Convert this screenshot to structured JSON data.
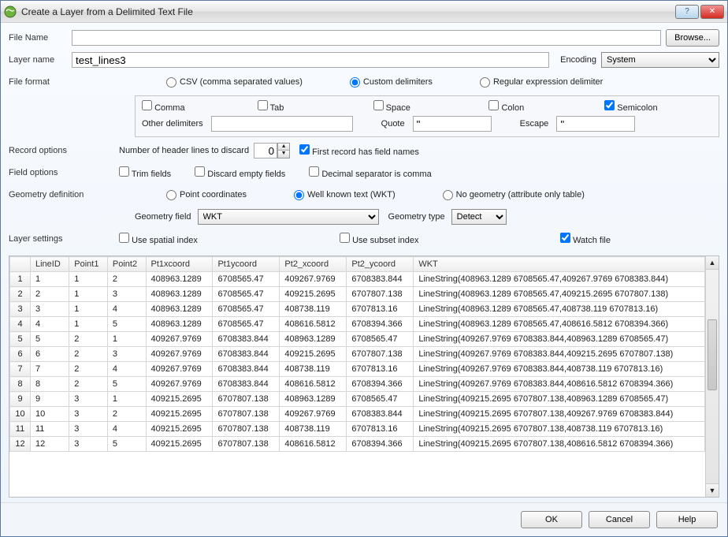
{
  "window": {
    "title": "Create a Layer from a Delimited Text File",
    "help_btn": "?",
    "close_btn": "✕"
  },
  "file": {
    "name_label": "File Name",
    "name_value": "",
    "browse_label": "Browse...",
    "layer_name_label": "Layer name",
    "layer_name_value": "test_lines3",
    "encoding_label": "Encoding",
    "encoding_value": "System"
  },
  "format": {
    "label": "File format",
    "csv_label": "CSV (comma separated values)",
    "custom_label": "Custom delimiters",
    "regex_label": "Regular expression delimiter",
    "comma_label": "Comma",
    "tab_label": "Tab",
    "space_label": "Space",
    "colon_label": "Colon",
    "semicolon_label": "Semicolon",
    "other_label": "Other delimiters",
    "other_value": "",
    "quote_label": "Quote",
    "quote_value": "\"",
    "escape_label": "Escape",
    "escape_value": "\""
  },
  "record": {
    "label": "Record options",
    "header_discard_label": "Number of header lines to discard",
    "header_discard_value": "0",
    "first_record_label": "First record has field names"
  },
  "fieldopt": {
    "label": "Field options",
    "trim_label": "Trim fields",
    "discard_empty_label": "Discard empty fields",
    "decimal_comma_label": "Decimal separator is comma"
  },
  "geom": {
    "label": "Geometry definition",
    "point_label": "Point coordinates",
    "wkt_label": "Well known text (WKT)",
    "nogeom_label": "No geometry (attribute only table)",
    "geomfield_label": "Geometry field",
    "geomfield_value": "WKT",
    "geomtype_label": "Geometry type",
    "geomtype_value": "Detect"
  },
  "layerset": {
    "label": "Layer settings",
    "spatial_label": "Use spatial index",
    "subset_label": "Use subset index",
    "watch_label": "Watch file"
  },
  "table": {
    "headers": [
      "LineID",
      "Point1",
      "Point2",
      "Pt1xcoord",
      "Pt1ycoord",
      "Pt2_xcoord",
      "Pt2_ycoord",
      "WKT"
    ],
    "rows": [
      [
        "1",
        "1",
        "2",
        "408963.1289",
        "6708565.47",
        "409267.9769",
        "6708383.844",
        "LineString(408963.1289 6708565.47,409267.9769 6708383.844)"
      ],
      [
        "2",
        "1",
        "3",
        "408963.1289",
        "6708565.47",
        "409215.2695",
        "6707807.138",
        "LineString(408963.1289 6708565.47,409215.2695 6707807.138)"
      ],
      [
        "3",
        "1",
        "4",
        "408963.1289",
        "6708565.47",
        "408738.119",
        "6707813.16",
        "LineString(408963.1289 6708565.47,408738.119 6707813.16)"
      ],
      [
        "4",
        "1",
        "5",
        "408963.1289",
        "6708565.47",
        "408616.5812",
        "6708394.366",
        "LineString(408963.1289 6708565.47,408616.5812 6708394.366)"
      ],
      [
        "5",
        "2",
        "1",
        "409267.9769",
        "6708383.844",
        "408963.1289",
        "6708565.47",
        "LineString(409267.9769 6708383.844,408963.1289 6708565.47)"
      ],
      [
        "6",
        "2",
        "3",
        "409267.9769",
        "6708383.844",
        "409215.2695",
        "6707807.138",
        "LineString(409267.9769 6708383.844,409215.2695 6707807.138)"
      ],
      [
        "7",
        "2",
        "4",
        "409267.9769",
        "6708383.844",
        "408738.119",
        "6707813.16",
        "LineString(409267.9769 6708383.844,408738.119 6707813.16)"
      ],
      [
        "8",
        "2",
        "5",
        "409267.9769",
        "6708383.844",
        "408616.5812",
        "6708394.366",
        "LineString(409267.9769 6708383.844,408616.5812 6708394.366)"
      ],
      [
        "9",
        "3",
        "1",
        "409215.2695",
        "6707807.138",
        "408963.1289",
        "6708565.47",
        "LineString(409215.2695 6707807.138,408963.1289 6708565.47)"
      ],
      [
        "10",
        "3",
        "2",
        "409215.2695",
        "6707807.138",
        "409267.9769",
        "6708383.844",
        "LineString(409215.2695 6707807.138,409267.9769 6708383.844)"
      ],
      [
        "11",
        "3",
        "4",
        "409215.2695",
        "6707807.138",
        "408738.119",
        "6707813.16",
        "LineString(409215.2695 6707807.138,408738.119 6707813.16)"
      ],
      [
        "12",
        "3",
        "5",
        "409215.2695",
        "6707807.138",
        "408616.5812",
        "6708394.366",
        "LineString(409215.2695 6707807.138,408616.5812 6708394.366)"
      ]
    ]
  },
  "footer": {
    "ok_label": "OK",
    "cancel_label": "Cancel",
    "help_label": "Help"
  }
}
